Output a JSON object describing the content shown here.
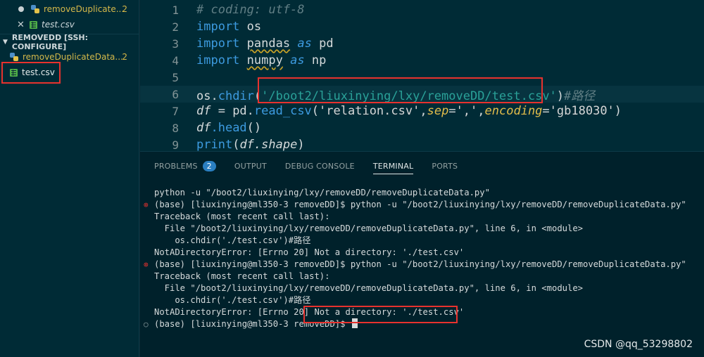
{
  "sidebar": {
    "open_editors": [
      {
        "name": "removeDuplicate...",
        "count": "2",
        "icon": "python-file-icon",
        "state": "modified"
      },
      {
        "name": "test.csv",
        "icon": "csv-file-icon",
        "state": "close"
      }
    ],
    "section_title": "REMOVEDD [SSH: CONFIGURE]",
    "files": [
      {
        "name": "removeDuplicateData...",
        "count": "2",
        "icon": "python-file-icon"
      },
      {
        "name": "test.csv",
        "icon": "csv-file-icon"
      }
    ]
  },
  "editor": {
    "lines": [
      {
        "n": "1"
      },
      {
        "n": "2"
      },
      {
        "n": "3"
      },
      {
        "n": "4"
      },
      {
        "n": "5"
      },
      {
        "n": "6"
      },
      {
        "n": "7"
      },
      {
        "n": "8"
      },
      {
        "n": "9"
      }
    ],
    "code": {
      "l1_comment": "# coding: utf-8",
      "l2_import": "import",
      "l2_mod": "os",
      "l3_import": "import",
      "l3_mod": "pandas",
      "l3_as": "as",
      "l3_alias": "pd",
      "l4_import": "import",
      "l4_mod": "numpy",
      "l4_as": "as",
      "l4_alias": "np",
      "l6_obj": "os.",
      "l6_fn": "chdir",
      "l6_open": "(",
      "l6_str": "'/boot2/liuxinying/lxy/removeDD/test.csv'",
      "l6_close": ")",
      "l6_comment": "#路径",
      "l7_var": "df",
      "l7_eq": " = pd.",
      "l7_fn": "read_csv",
      "l7_open": "(",
      "l7_str1": "'relation.csv'",
      "l7_comma1": ",",
      "l7_p1": "sep",
      "l7_eq1": "=",
      "l7_str2": "','",
      "l7_comma2": ",",
      "l7_p2": "encoding",
      "l7_eq2": "=",
      "l7_str3": "'gb18030'",
      "l7_close": ")",
      "l8_var": "df",
      "l8_fn": ".head",
      "l8_paren": "()",
      "l9_fn": "print",
      "l9_open": "(",
      "l9_var": "df.shape",
      "l9_close": ")"
    }
  },
  "panel": {
    "tabs": [
      {
        "label": "PROBLEMS",
        "badge": "2"
      },
      {
        "label": "OUTPUT"
      },
      {
        "label": "DEBUG CONSOLE"
      },
      {
        "label": "TERMINAL",
        "active": true
      },
      {
        "label": "PORTS"
      }
    ],
    "terminal_lines": [
      {
        "mark": "",
        "text": "python -u \"/boot2/liuxinying/lxy/removeDD/removeDuplicateData.py\""
      },
      {
        "mark": "err",
        "text": "(base) [liuxinying@ml350-3 removeDD]$ python -u \"/boot2/liuxinying/lxy/removeDD/removeDuplicateData.py\""
      },
      {
        "mark": "",
        "text": "Traceback (most recent call last):"
      },
      {
        "mark": "",
        "text": "  File \"/boot2/liuxinying/lxy/removeDD/removeDuplicateData.py\", line 6, in <module>"
      },
      {
        "mark": "",
        "text": "    os.chdir('./test.csv')#路径"
      },
      {
        "mark": "",
        "text": "NotADirectoryError: [Errno 20] Not a directory: './test.csv'"
      },
      {
        "mark": "err",
        "text": "(base) [liuxinying@ml350-3 removeDD]$ python -u \"/boot2/liuxinying/lxy/removeDD/removeDuplicateData.py\""
      },
      {
        "mark": "",
        "text": "Traceback (most recent call last):"
      },
      {
        "mark": "",
        "text": "  File \"/boot2/liuxinying/lxy/removeDD/removeDuplicateData.py\", line 6, in <module>"
      },
      {
        "mark": "",
        "text": "    os.chdir('./test.csv')#路径"
      },
      {
        "mark": "",
        "text": "NotADirectoryError: [Errno 20] Not a directory: './test.csv'"
      },
      {
        "mark": "ok",
        "text": "(base) [liuxinying@ml350-3 removeDD]$ "
      }
    ]
  },
  "watermark": "CSDN @qq_53298802",
  "colors": {
    "background": "#002b36",
    "panel_bg": "#00212b",
    "keyword": "#3d9be0",
    "string": "#2aa198",
    "error_mark": "#dc322f",
    "highlight_box": "#e8322e"
  }
}
